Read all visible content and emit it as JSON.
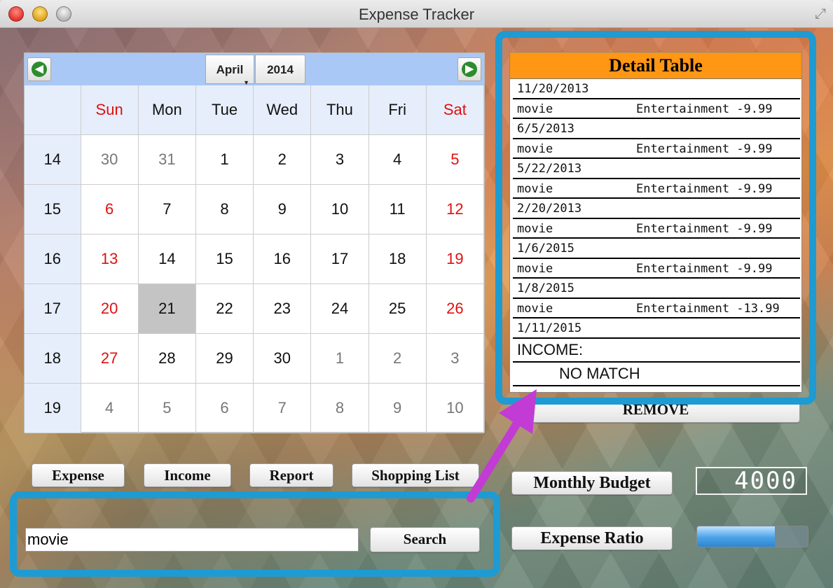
{
  "window": {
    "title": "Expense Tracker"
  },
  "calendar": {
    "month": "April",
    "year": "2014",
    "weekdays": [
      "Sun",
      "Mon",
      "Tue",
      "Wed",
      "Thu",
      "Fri",
      "Sat"
    ],
    "weeks": [
      {
        "num": "14",
        "days": [
          "30",
          "31",
          "1",
          "2",
          "3",
          "4",
          "5"
        ]
      },
      {
        "num": "15",
        "days": [
          "6",
          "7",
          "8",
          "9",
          "10",
          "11",
          "12"
        ]
      },
      {
        "num": "16",
        "days": [
          "13",
          "14",
          "15",
          "16",
          "17",
          "18",
          "19"
        ]
      },
      {
        "num": "17",
        "days": [
          "20",
          "21",
          "22",
          "23",
          "24",
          "25",
          "26"
        ]
      },
      {
        "num": "18",
        "days": [
          "27",
          "28",
          "29",
          "30",
          "1",
          "2",
          "3"
        ]
      },
      {
        "num": "19",
        "days": [
          "4",
          "5",
          "6",
          "7",
          "8",
          "9",
          "10"
        ]
      }
    ],
    "selected_day": "21"
  },
  "buttons": {
    "expense": "Expense",
    "income": "Income",
    "report": "Report",
    "shopping_list": "Shopping List",
    "search": "Search",
    "remove": "REMOVE",
    "monthly_budget": "Monthly Budget",
    "expense_ratio": "Expense Ratio"
  },
  "search": {
    "value": "movie"
  },
  "budget": {
    "display": "4000"
  },
  "expense_ratio": {
    "fill_fraction": 0.7
  },
  "detail_table": {
    "title": "Detail  Table",
    "rows": [
      {
        "date": "11/20/2013",
        "name": "movie",
        "category": "Entertainment",
        "amount": "-9.99"
      },
      {
        "date": "6/5/2013",
        "name": "movie",
        "category": "Entertainment",
        "amount": "-9.99"
      },
      {
        "date": "5/22/2013",
        "name": "movie",
        "category": "Entertainment",
        "amount": "-9.99"
      },
      {
        "date": "2/20/2013",
        "name": "movie",
        "category": "Entertainment",
        "amount": "-9.99"
      },
      {
        "date": "1/6/2015",
        "name": "movie",
        "category": "Entertainment",
        "amount": "-9.99"
      },
      {
        "date": "1/8/2015",
        "name": "movie",
        "category": "Entertainment",
        "amount": "-13.99"
      }
    ],
    "last_date": "1/11/2015",
    "income_label": "INCOME:",
    "no_match": "NO MATCH"
  },
  "colors": {
    "highlight_frame": "#1e9bd2",
    "arrow": "#c23bd4",
    "detail_header": "#ff9614",
    "weekend_text": "#e01010"
  }
}
